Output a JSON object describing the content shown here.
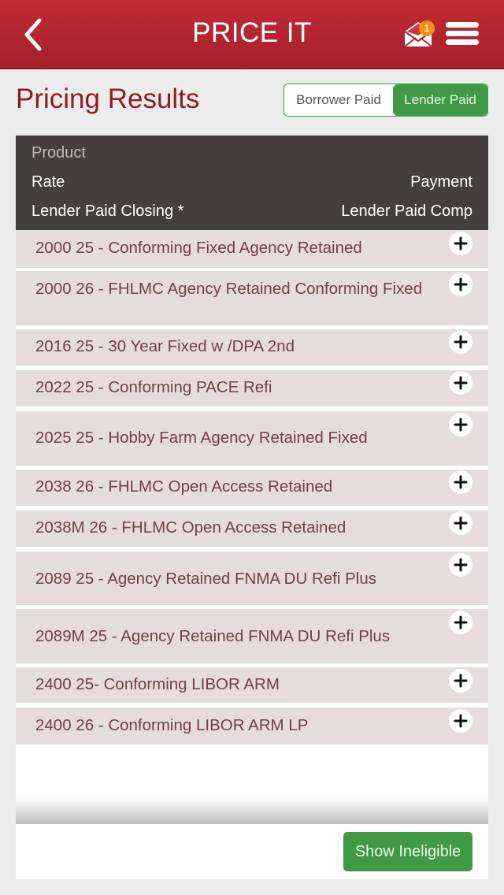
{
  "header": {
    "title": "PRICE IT",
    "back_icon": "chevron-left-icon",
    "mail_icon": "envelope-open-icon",
    "notification_count": "1",
    "menu_icon": "hamburger-menu-icon"
  },
  "page": {
    "title": "Pricing Results"
  },
  "toggle": {
    "options": [
      {
        "label": "Borrower Paid",
        "selected": false
      },
      {
        "label": "Lender Paid",
        "selected": true
      }
    ]
  },
  "table": {
    "headers": {
      "product": "Product",
      "rate": "Rate",
      "payment": "Payment",
      "closing": "Lender Paid Closing *",
      "comp": "Lender Paid Comp"
    },
    "rows": [
      {
        "label": "2000  25 - Conforming Fixed Agency Retained"
      },
      {
        "label": "2000 26 - FHLMC Agency Retained Conforming Fixed"
      },
      {
        "label": "2016  25 - 30 Year Fixed w /DPA 2nd"
      },
      {
        "label": "2022  25 - Conforming PACE Refi"
      },
      {
        "label": "2025  25 - Hobby Farm Agency Retained Fixed"
      },
      {
        "label": "2038 26 - FHLMC Open Access Retained"
      },
      {
        "label": "2038M 26 - FHLMC Open Access Retained"
      },
      {
        "label": "2089  25 - Agency Retained FNMA DU Refi Plus"
      },
      {
        "label": "2089M  25 - Agency Retained FNMA DU Refi Plus"
      },
      {
        "label": "2400   25- Conforming LIBOR ARM"
      },
      {
        "label": "2400  26 - Conforming LIBOR ARM LP"
      }
    ],
    "expand_icon": "plus-icon"
  },
  "footer": {
    "show_ineligible": "Show Ineligible"
  },
  "colors": {
    "header_red": "#b0232e",
    "title_red": "#8e1d24",
    "accent_green": "#3f9a43",
    "table_header": "#433f3e",
    "row_bg": "#e7dcdd",
    "badge_orange": "#f39019"
  }
}
